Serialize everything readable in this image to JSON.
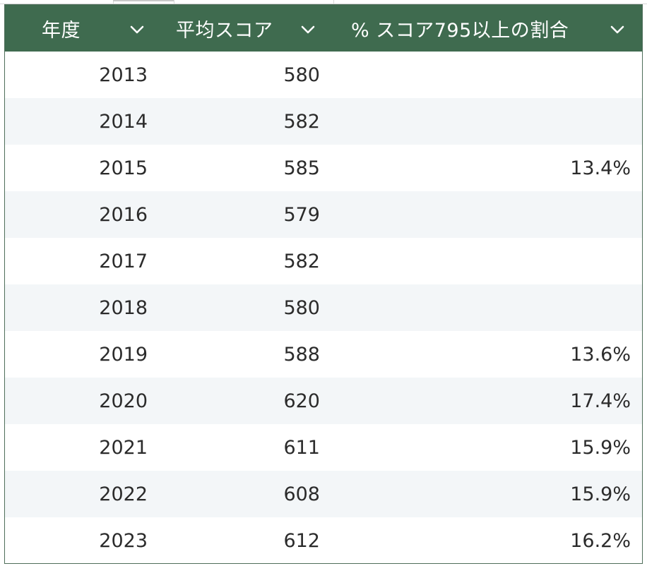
{
  "table": {
    "headers": [
      {
        "label": "年度",
        "has_filter": true
      },
      {
        "label": "平均スコア",
        "has_filter": true
      },
      {
        "label": "% スコア795以上の割合",
        "has_filter": true
      }
    ],
    "rows": [
      {
        "year": "2013",
        "avg": "580",
        "pct": ""
      },
      {
        "year": "2014",
        "avg": "582",
        "pct": ""
      },
      {
        "year": "2015",
        "avg": "585",
        "pct": "13.4%"
      },
      {
        "year": "2016",
        "avg": "579",
        "pct": ""
      },
      {
        "year": "2017",
        "avg": "582",
        "pct": ""
      },
      {
        "year": "2018",
        "avg": "580",
        "pct": ""
      },
      {
        "year": "2019",
        "avg": "588",
        "pct": "13.6%"
      },
      {
        "year": "2020",
        "avg": "620",
        "pct": "17.4%"
      },
      {
        "year": "2021",
        "avg": "611",
        "pct": "15.9%"
      },
      {
        "year": "2022",
        "avg": "608",
        "pct": "15.9%"
      },
      {
        "year": "2023",
        "avg": "612",
        "pct": "16.2%"
      }
    ]
  },
  "colors": {
    "header_bg": "#3f6b4f",
    "header_text": "#ffffff",
    "alt_row_bg": "#f3f6f8",
    "border": "#4e6e5a"
  },
  "icons": {
    "filter": "chevron-down-icon"
  }
}
